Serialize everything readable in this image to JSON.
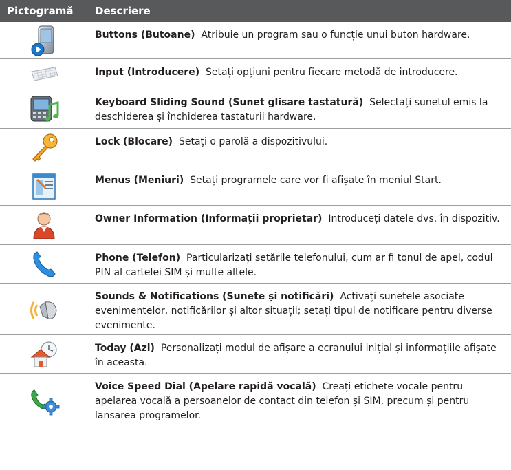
{
  "header": {
    "col_icon": "Pictogramă",
    "col_desc": "Descriere"
  },
  "rows": [
    {
      "icon": "buttons-pda-icon",
      "title": "Buttons (Butoane)",
      "text": "Atribuie un program sau o funcție unui buton hardware."
    },
    {
      "icon": "keyboard-icon",
      "title": "Input (Introducere)",
      "text": "Setați opțiuni pentru fiecare metodă de introducere."
    },
    {
      "icon": "phone-music-icon",
      "title": "Keyboard Sliding Sound (Sunet glisare tastatură)",
      "text": "Selectați sunetul emis la deschiderea și închiderea tastaturii hardware."
    },
    {
      "icon": "key-icon",
      "title": "Lock (Blocare)",
      "text": "Setați o parolă a dispozitivului."
    },
    {
      "icon": "menu-window-icon",
      "title": "Menus (Meniuri)",
      "text": "Setați programele care vor fi afișate în meniul Start."
    },
    {
      "icon": "owner-person-icon",
      "title": "Owner Information (Informații proprietar)",
      "text": "Introduceți datele dvs. în dispozitiv."
    },
    {
      "icon": "phone-handset-icon",
      "title": "Phone (Telefon)",
      "text": "Particularizați setările telefonului, cum ar fi tonul de apel, codul PIN al cartelei SIM și multe altele."
    },
    {
      "icon": "speaker-sound-icon",
      "title": "Sounds & Notifications (Sunete și notificări)",
      "text": "Activați sunetele asociate evenimentelor, notificărilor și altor situații; setați tipul de notificare pentru diverse evenimente."
    },
    {
      "icon": "home-clock-icon",
      "title": "Today (Azi)",
      "text": "Personalizați modul de afișare a ecranului inițial și informațiile afișate în aceasta."
    },
    {
      "icon": "voice-dial-gear-icon",
      "title": "Voice Speed Dial (Apelare rapidă vocală)",
      "text": "Creați etichete vocale pentru apelarea vocală a persoanelor de contact din telefon și SIM, precum și pentru lansarea programelor."
    }
  ]
}
